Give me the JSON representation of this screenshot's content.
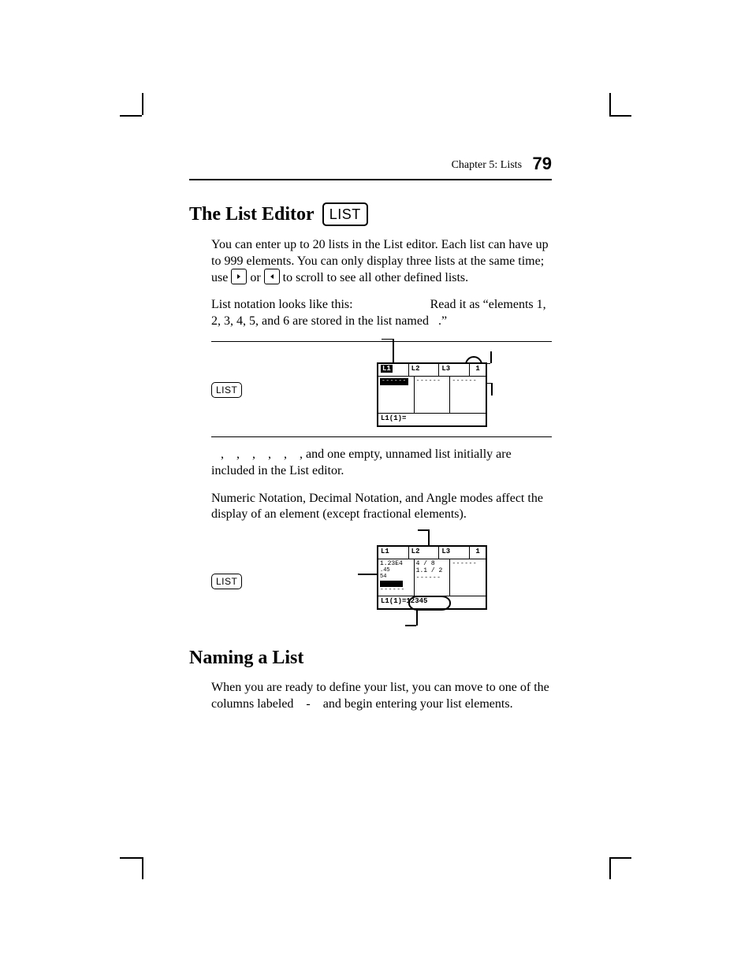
{
  "header": {
    "running": "Chapter 5: Lists",
    "page": "79"
  },
  "section1": {
    "title": "The List Editor",
    "key": "LIST",
    "p1_a": "You can enter up to 20 lists in the List editor. Each list can have up to 999 elements. You can only display three lists at the same time; use ",
    "p1_b": " or ",
    "p1_c": " to scroll to see all other defined lists.",
    "p2_a": "List notation looks like this:",
    "p2_b": "Read it as “elements 1, 2, 3, 4, 5, and 6 are stored in the list named   .”",
    "fig1_label_key": "LIST",
    "p3": "   ,    ,    ,    ,    ,    , and one empty, unnamed list initially are included in the List editor.",
    "p4": "Numeric Notation, Decimal Notation, and Angle modes affect the display of an element (except fractional elements).",
    "fig2_label_key": "LIST"
  },
  "section2": {
    "title": "Naming a List",
    "p1": "When you are ready to define your list, you can move to one of the columns labeled    -    and begin entering your list elements."
  },
  "calc": {
    "h1": "L1",
    "h2": "L2",
    "h3": "L3",
    "hidx": "1",
    "dashes": "------",
    "foot1": "L1(1)=",
    "sci": "1.23E4",
    "frac_a": "4 / 8",
    "frac_b": "1.1 / 2",
    "val_focus": "12345",
    "foot2": "L1(1)="
  }
}
